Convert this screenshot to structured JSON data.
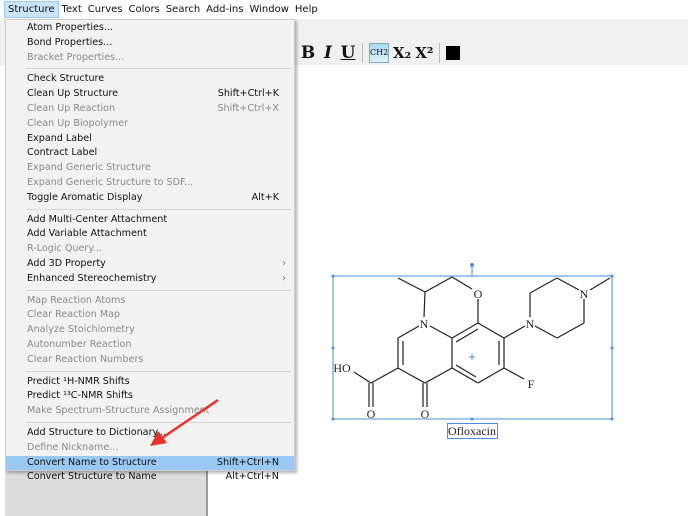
{
  "menubar": [
    "Structure",
    "Text",
    "Curves",
    "Colors",
    "Search",
    "Add-ins",
    "Window",
    "Help"
  ],
  "toolbar": {
    "bold": "B",
    "italic": "I",
    "underline": "U",
    "chemical_style": "CH2",
    "subscript": "X₂",
    "superscript": "X²",
    "color": "#000000"
  },
  "menu": {
    "groups": [
      [
        {
          "label": "Atom Properties...",
          "enabled": true
        },
        {
          "label": "Bond Properties...",
          "enabled": true
        },
        {
          "label": "Bracket Properties...",
          "enabled": false
        }
      ],
      [
        {
          "label": "Check Structure",
          "enabled": true
        },
        {
          "label": "Clean Up Structure",
          "shortcut": "Shift+Ctrl+K",
          "enabled": true
        },
        {
          "label": "Clean Up Reaction",
          "shortcut": "Shift+Ctrl+X",
          "enabled": false
        },
        {
          "label": "Clean Up Biopolymer",
          "enabled": false
        },
        {
          "label": "Expand Label",
          "enabled": true
        },
        {
          "label": "Contract Label",
          "enabled": true
        },
        {
          "label": "Expand Generic Structure",
          "enabled": false
        },
        {
          "label": "Expand Generic Structure to SDF...",
          "enabled": false
        },
        {
          "label": "Toggle Aromatic Display",
          "shortcut": "Alt+K",
          "enabled": true
        }
      ],
      [
        {
          "label": "Add Multi-Center Attachment",
          "enabled": true
        },
        {
          "label": "Add Variable Attachment",
          "enabled": true
        },
        {
          "label": "R-Logic Query...",
          "enabled": false
        },
        {
          "label": "Add 3D Property",
          "enabled": true,
          "submenu": true
        },
        {
          "label": "Enhanced Stereochemistry",
          "enabled": true,
          "submenu": true
        }
      ],
      [
        {
          "label": "Map Reaction Atoms",
          "enabled": false
        },
        {
          "label": "Clear Reaction Map",
          "enabled": false
        },
        {
          "label": "Analyze Stoichiometry",
          "enabled": false
        },
        {
          "label": "Autonumber Reaction",
          "enabled": false
        },
        {
          "label": "Clear Reaction Numbers",
          "enabled": false
        }
      ],
      [
        {
          "label": "Predict ¹H-NMR Shifts",
          "enabled": true
        },
        {
          "label": "Predict ¹³C-NMR Shifts",
          "enabled": true
        },
        {
          "label": "Make Spectrum-Structure Assignment",
          "enabled": false
        }
      ],
      [
        {
          "label": "Add Structure to Dictionary...",
          "enabled": true
        },
        {
          "label": "Define Nickname...",
          "enabled": false
        },
        {
          "label": "Convert Name to Structure",
          "shortcut": "Shift+Ctrl+N",
          "enabled": true,
          "highlighted": true
        },
        {
          "label": "Convert Structure to Name",
          "shortcut": "Alt+Ctrl+N",
          "enabled": true
        }
      ]
    ]
  },
  "molecule": {
    "name": "Ofloxacin",
    "atoms": {
      "O": "O",
      "N": "N",
      "HO": "HO",
      "F": "F"
    }
  },
  "colors": {
    "highlight": "#99c9f2",
    "selection": "#4a90d9",
    "arrow": "#e8322b"
  }
}
